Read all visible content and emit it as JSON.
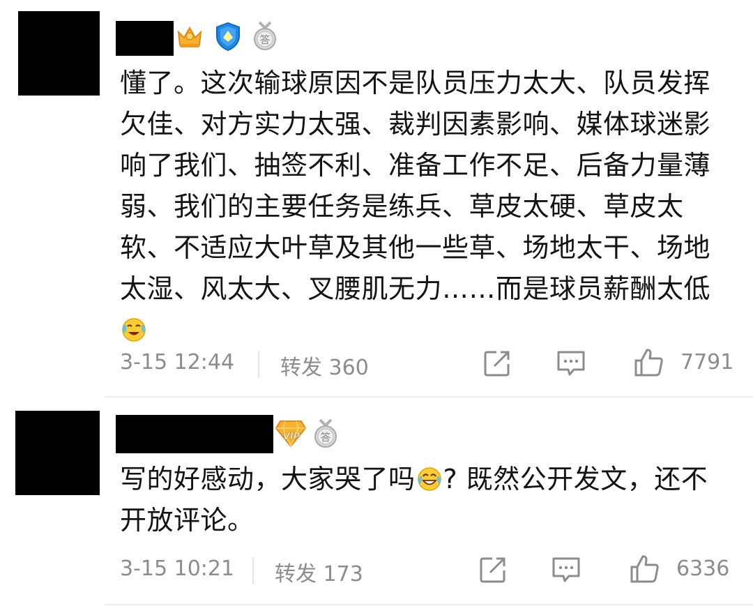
{
  "comments": [
    {
      "text": "懂了。这次输球原因不是队员压力太大、队员发挥欠佳、对方实力太强、裁判因素影响、媒体球迷影响了我们、抽签不利、准备工作不足、后备力量薄弱、我们的主要任务是练兵、草皮太硬、草皮太软、不适应大叶草及其他一些草、场地太干、场地太湿、风太大、叉腰肌无力……而是球员薪酬太低",
      "emoji": "crying-laughing-emoji",
      "date": "3-15 12:44",
      "repost_label": "转发 360",
      "like_count": "7791",
      "badges": [
        "vip-gold-crown-icon",
        "blue-shield-badge-icon",
        "silver-answer-medal-icon"
      ],
      "badge_text": "答"
    },
    {
      "text_before": "写的好感动，大家哭了吗",
      "text_after": "? 既然公开发文，还不开放评论。",
      "emoji": "tears-of-joy-emoji",
      "date": "3-15 10:21",
      "repost_label": "转发 173",
      "like_count": "6336",
      "badges": [
        "vip-gold-diamond-icon",
        "silver-answer-medal-icon"
      ],
      "badge_vip_text": "VIP",
      "badge_text": "答"
    }
  ],
  "icons": {
    "share": "share-icon",
    "comment": "comment-icon",
    "like": "thumbs-up-icon"
  },
  "colors": {
    "meta_text": "#8c8c8c",
    "body_text": "#141414",
    "redaction": "#000000",
    "gold": "#f5a623",
    "blue": "#1e88e5"
  }
}
